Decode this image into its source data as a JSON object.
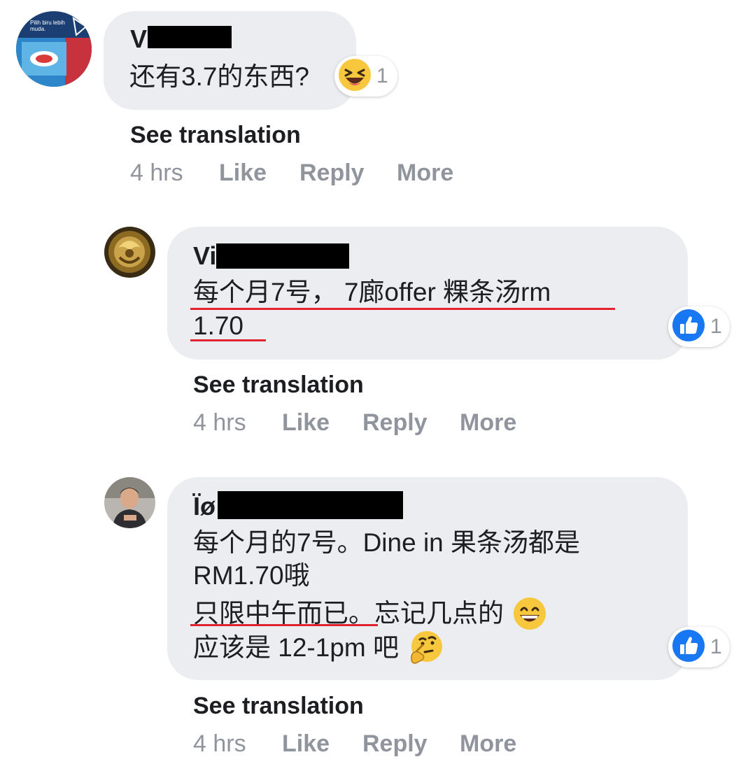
{
  "comments": [
    {
      "author_visible": "Vi",
      "avatar": "party-flag-avatar",
      "avatar_text": "Pilih biru lebih muda.",
      "lines": [
        "还有3.7的东西?"
      ],
      "reaction": {
        "icon": "laughing-emoji-icon",
        "count": "1"
      },
      "see_translation": "See translation",
      "time": "4 hrs",
      "actions": [
        "Like",
        "Reply",
        "More"
      ]
    },
    {
      "author_visible": "Vi",
      "avatar": "golden-ornament-avatar",
      "lines": [
        "每个月7号， 7廊offer 粿条汤rm",
        "1.70"
      ],
      "reaction": {
        "icon": "thumbs-up-icon",
        "count": "1"
      },
      "see_translation": "See translation",
      "time": "4 hrs",
      "actions": [
        "Like",
        "Reply",
        "More"
      ]
    },
    {
      "author_visible": "Ïø",
      "avatar": "person-photo-avatar",
      "lines": [
        "每个月的7号。Dine in 果条汤都是",
        "RM1.70哦",
        "只限中午而已。忘记几点的",
        "应该是 12-1pm 吧"
      ],
      "inline_emojis": [
        "grinning-emoji-icon",
        "thinking-emoji-icon"
      ],
      "reaction": {
        "icon": "thumbs-up-icon",
        "count": "1"
      },
      "see_translation": "See translation",
      "time": "4 hrs",
      "actions": [
        "Like",
        "Reply",
        "More"
      ]
    }
  ],
  "colors": {
    "bubble": "#ebedf0",
    "meta_text": "#90949c",
    "like_blue": "#1877f2",
    "underline_red": "#e0232e"
  }
}
